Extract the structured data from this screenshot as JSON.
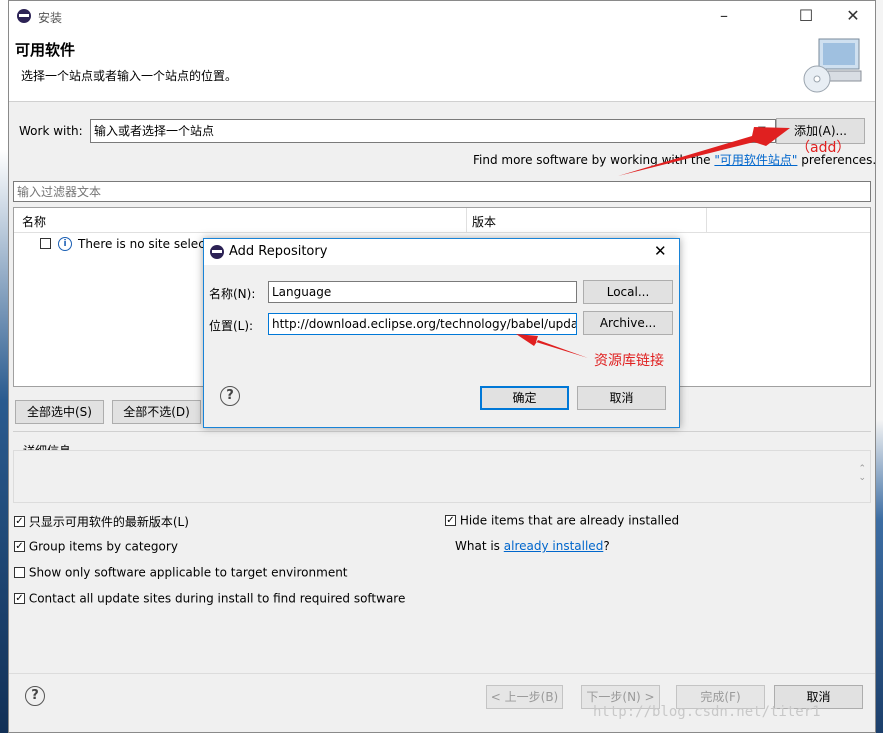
{
  "window": {
    "title": "安装",
    "page_title": "可用软件",
    "page_subtitle": "选择一个站点或者输入一个站点的位置。"
  },
  "work_with": {
    "label": "Work with:",
    "value": "输入或者选择一个站点",
    "add_button": "添加(A)...",
    "find_more_prefix": "Find more software by working with the",
    "find_more_link": "\"可用软件站点\"",
    "find_more_suffix": "preferences."
  },
  "filter": {
    "placeholder": "输入过滤器文本"
  },
  "table": {
    "columns": [
      "名称",
      "版本"
    ],
    "rows": [
      {
        "label": "There is no site selected."
      }
    ]
  },
  "select_buttons": {
    "select_all": "全部选中(S)",
    "deselect_all": "全部不选(D)"
  },
  "details": {
    "label": "详细信息"
  },
  "options": {
    "show_latest": {
      "label": "只显示可用软件的最新版本(L)",
      "checked": true
    },
    "group_by_category": {
      "label": "Group items by category",
      "checked": true
    },
    "target_env": {
      "label": "Show only software applicable to target environment",
      "checked": false
    },
    "contact_sites": {
      "label": "Contact all update sites during install to find required software",
      "checked": true
    },
    "hide_installed": {
      "label": "Hide items that are already installed",
      "checked": true
    },
    "what_is_prefix": "What is",
    "what_is_link": "already installed",
    "what_is_suffix": "?"
  },
  "footer": {
    "back": "< 上一步(B)",
    "next": "下一步(N) >",
    "finish": "完成(F)",
    "cancel": "取消"
  },
  "dialog": {
    "title": "Add Repository",
    "name_label": "名称(N):",
    "name_value": "Language",
    "location_label": "位置(L):",
    "location_value": "http://download.eclipse.org/technology/babel/upda",
    "local_button": "Local...",
    "archive_button": "Archive...",
    "ok_button": "确定",
    "cancel_button": "取消"
  },
  "annotations": {
    "add_note": "（add）",
    "repo_note": "资源库链接"
  },
  "watermark": "http://blog.csdn.net/titer1",
  "colors": {
    "accent": "#0078d7",
    "annotation": "#e02020",
    "link": "#0066cc"
  }
}
